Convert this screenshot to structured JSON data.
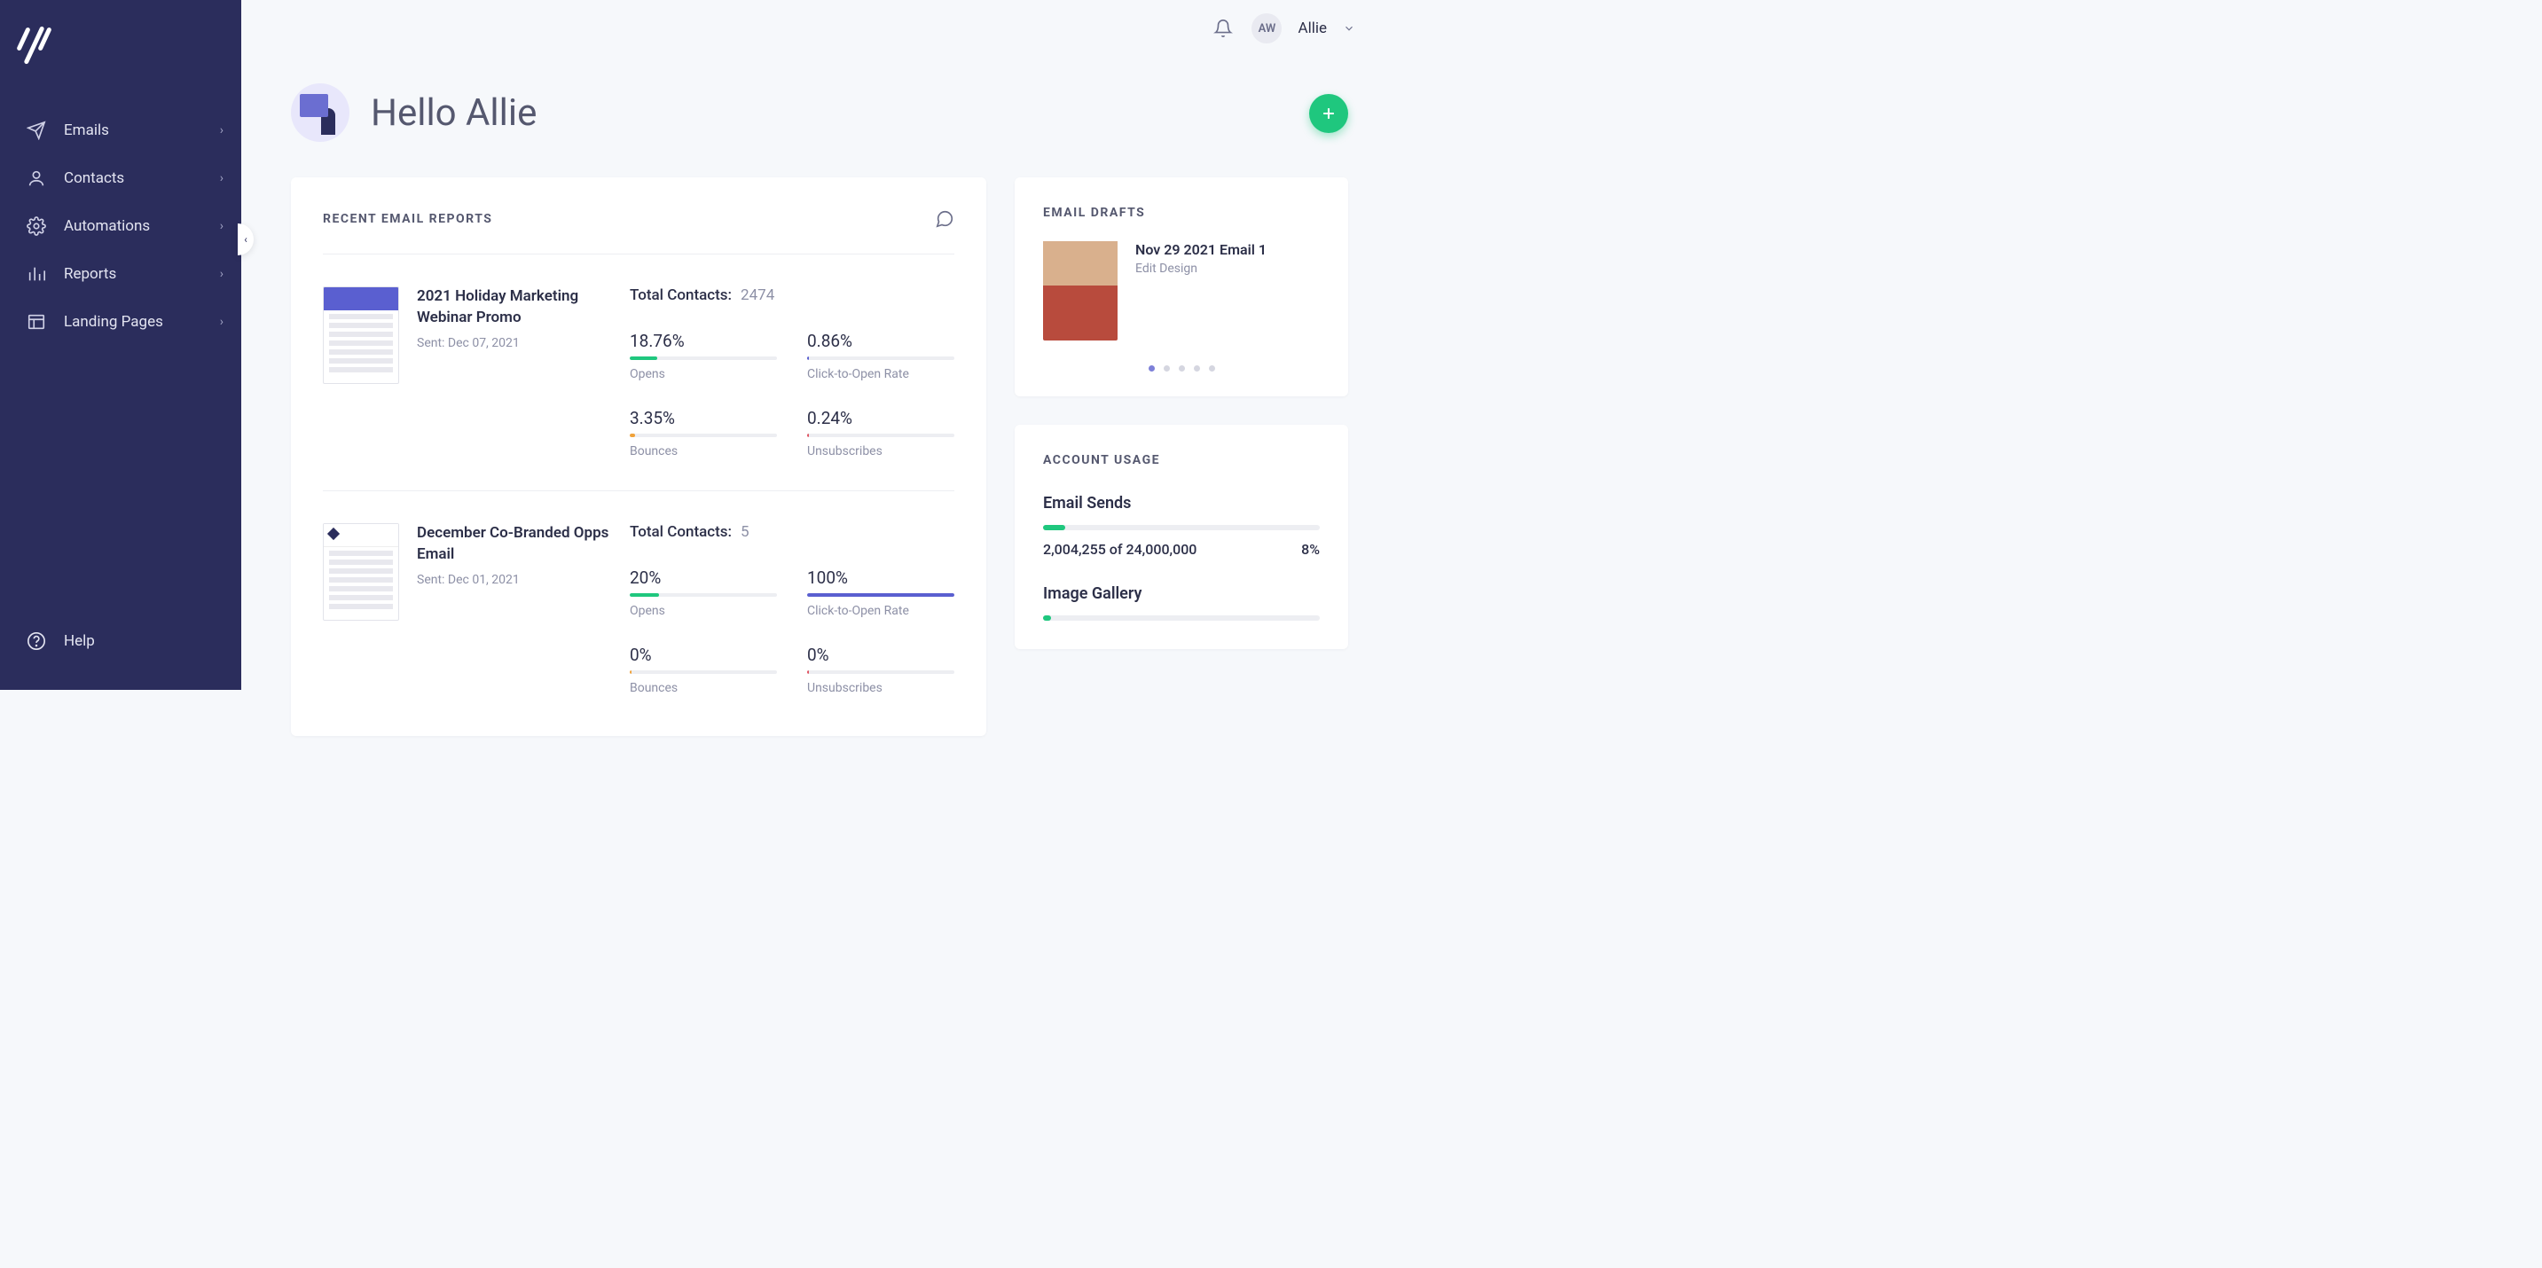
{
  "sidebar": {
    "items": [
      {
        "label": "Emails",
        "icon": "paper-plane-icon"
      },
      {
        "label": "Contacts",
        "icon": "person-icon"
      },
      {
        "label": "Automations",
        "icon": "gear-icon"
      },
      {
        "label": "Reports",
        "icon": "bar-chart-icon"
      },
      {
        "label": "Landing Pages",
        "icon": "layout-icon"
      }
    ],
    "help_label": "Help"
  },
  "header": {
    "user_initials": "AW",
    "user_name": "Allie"
  },
  "greeting": "Hello Allie",
  "reports_section": {
    "title": "RECENT EMAIL REPORTS",
    "contacts_label": "Total Contacts:",
    "metric_labels": {
      "opens": "Opens",
      "ctor": "Click-to-Open Rate",
      "bounces": "Bounces",
      "unsubs": "Unsubscribes"
    },
    "items": [
      {
        "title": "2021 Holiday Marketing Webinar Promo",
        "sent": "Sent: Dec 07, 2021",
        "contacts": "2474",
        "opens": {
          "value": "18.76%",
          "pct": 18.76,
          "color": "#1fc77e"
        },
        "ctor": {
          "value": "0.86%",
          "pct": 0.86,
          "color": "#5a5fd0"
        },
        "bounces": {
          "value": "3.35%",
          "pct": 3.35,
          "color": "#f0a23a"
        },
        "unsubs": {
          "value": "0.24%",
          "pct": 0.24,
          "color": "#e05563"
        }
      },
      {
        "title": "December Co-Branded Opps Email",
        "sent": "Sent: Dec 01, 2021",
        "contacts": "5",
        "opens": {
          "value": "20%",
          "pct": 20,
          "color": "#1fc77e"
        },
        "ctor": {
          "value": "100%",
          "pct": 100,
          "color": "#5a5fd0"
        },
        "bounces": {
          "value": "0%",
          "pct": 0,
          "color": "#f0a23a"
        },
        "unsubs": {
          "value": "0%",
          "pct": 0,
          "color": "#e05563"
        }
      }
    ]
  },
  "drafts_section": {
    "title": "EMAIL DRAFTS",
    "item": {
      "title": "Nov 29 2021 Email 1",
      "action": "Edit Design"
    },
    "dot_count": 5,
    "active_dot": 0
  },
  "usage_section": {
    "title": "ACCOUNT USAGE",
    "sends": {
      "label": "Email Sends",
      "text": "2,004,255 of 24,000,000",
      "pct_text": "8%",
      "pct": 8
    },
    "gallery": {
      "label": "Image Gallery",
      "pct": 3
    }
  }
}
